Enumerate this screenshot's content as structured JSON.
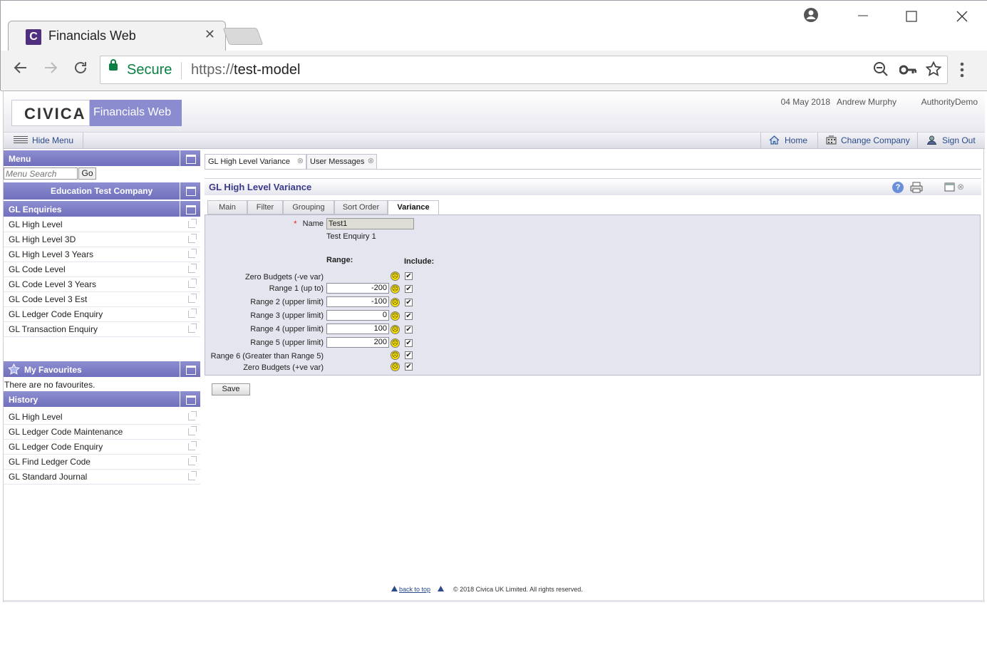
{
  "browser": {
    "tab_title": "Financials Web",
    "tab_close": "✕",
    "tab_favicon": "C",
    "secure_label": "Secure",
    "url_scheme": "https://",
    "url_host": "test-model"
  },
  "header": {
    "logo": "CIVICA",
    "brand": "Financials Web",
    "date": "04 May 2018",
    "user": "Andrew Murphy",
    "authority": "AuthorityDemo"
  },
  "menubar": {
    "hide_menu": "Hide Menu",
    "home": "Home",
    "change_company": "Change Company",
    "sign_out": "Sign Out"
  },
  "sidebar": {
    "menu_title": "Menu",
    "search_placeholder": "Menu Search",
    "go_label": "Go",
    "company": "Education Test Company",
    "section_title": "GL Enquiries",
    "items": [
      "GL High Level",
      "GL High Level 3D",
      "GL High Level 3 Years",
      "GL Code Level",
      "GL Code Level 3 Years",
      "GL Code Level 3 Est",
      "GL Ledger Code Enquiry",
      "GL Transaction Enquiry"
    ],
    "favourites_title": "My Favourites",
    "no_favourites": "There are no favourites.",
    "history_title": "History",
    "history": [
      "GL High Level",
      "GL Ledger Code Maintenance",
      "GL Ledger Code Enquiry",
      "GL Find Ledger Code",
      "GL Standard Journal"
    ]
  },
  "content": {
    "doc_tabs": [
      "GL High Level Variance",
      "User Messages"
    ],
    "title": "GL High Level Variance",
    "help_icon": "?",
    "sub_tabs": [
      "Main",
      "Filter",
      "Grouping",
      "Sort Order",
      "Variance"
    ],
    "active_sub_tab": "Variance",
    "form": {
      "name_label": "Name",
      "required_mark": "*",
      "name_value": "Test1",
      "description": "Test Enquiry 1",
      "range_header": "Range:",
      "include_header": "Include:",
      "rows": [
        {
          "label": "Zero Budgets (-ve var)",
          "value": null,
          "checked": true
        },
        {
          "label": "Range 1 (up to)",
          "value": "-200",
          "checked": true
        },
        {
          "label": "Range 2 (upper limit)",
          "value": "-100",
          "checked": true
        },
        {
          "label": "Range 3 (upper limit)",
          "value": "0",
          "checked": true
        },
        {
          "label": "Range 4 (upper limit)",
          "value": "100",
          "checked": true
        },
        {
          "label": "Range 5 (upper limit)",
          "value": "200",
          "checked": true
        },
        {
          "label": "Range 6 (Greater than Range 5)",
          "value": null,
          "checked": true
        },
        {
          "label": "Zero Budgets (+ve var)",
          "value": null,
          "checked": true
        }
      ],
      "save_label": "Save"
    }
  },
  "footer": {
    "back_to_top": "back to top",
    "copyright": "© 2018 Civica UK Limited. All rights reserved."
  }
}
